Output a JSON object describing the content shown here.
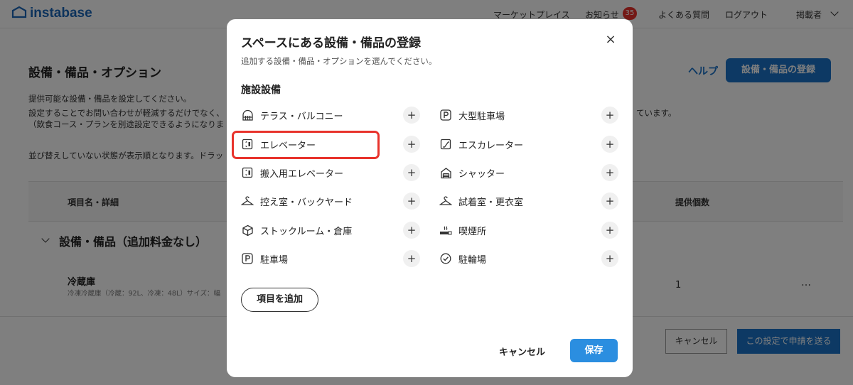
{
  "topnav": {
    "logo_text": "instabase",
    "items": [
      "マーケットプレイス",
      "お知らせ",
      "よくある質問",
      "ログアウト",
      "掲載者"
    ],
    "notification_count": "35"
  },
  "page": {
    "title": "設備・備品・オプション",
    "help_label": "ヘルプ",
    "register_button": "設備・備品の登録",
    "description_lines": [
      "提供可能な設備・備品を設定してください。",
      "設定することでお問い合わせが軽減するだけでなく、",
      "（飲食コース・プランを別途設定できるようになりま"
    ],
    "description_tail": "ています。",
    "sort_note": "並び替えしていない状態が表示順となります。ドラッ",
    "table": {
      "col_name": "項目名・詳細",
      "col_qty": "提供個数",
      "group_title": "設備・備品（追加料金なし）",
      "row": {
        "name": "冷蔵庫",
        "detail": "冷凍冷蔵庫（冷蔵：92L、冷凍：48L）サイズ：幅",
        "qty": "1",
        "more": "…"
      }
    },
    "footer": {
      "cancel": "キャンセル",
      "apply": "この設定で申請を送る"
    }
  },
  "modal": {
    "title": "スペースにある設備・備品の登録",
    "subtitle": "追加する設備・備品・オプションを選んでください。",
    "close": "×",
    "section": "施設設備",
    "items_left": [
      {
        "label": "テラス・バルコニー",
        "icon": "terrace-icon"
      },
      {
        "label": "エレベーター",
        "icon": "elevator-icon"
      },
      {
        "label": "搬入用エレベーター",
        "icon": "freight-elevator-icon"
      },
      {
        "label": "控え室・バックヤード",
        "icon": "hanger-icon"
      },
      {
        "label": "ストックルーム・倉庫",
        "icon": "box-icon"
      },
      {
        "label": "駐車場",
        "icon": "parking-icon"
      }
    ],
    "items_right": [
      {
        "label": "大型駐車場",
        "icon": "parking-icon"
      },
      {
        "label": "エスカレーター",
        "icon": "escalator-icon"
      },
      {
        "label": "シャッター",
        "icon": "shutter-icon"
      },
      {
        "label": "試着室・更衣室",
        "icon": "hanger-icon"
      },
      {
        "label": "喫煙所",
        "icon": "smoking-icon"
      },
      {
        "label": "駐輪場",
        "icon": "check-circle-icon"
      }
    ],
    "add_symbol": "+",
    "add_item_button": "項目を追加",
    "cancel": "キャンセル",
    "save": "保存",
    "highlighted_item": "エレベーター"
  },
  "colors": {
    "brand": "#1a66b8",
    "primary_button": "#1a73c8",
    "save_button": "#2b8ee0",
    "highlight": "#e8332c",
    "badge": "#e8332c"
  }
}
